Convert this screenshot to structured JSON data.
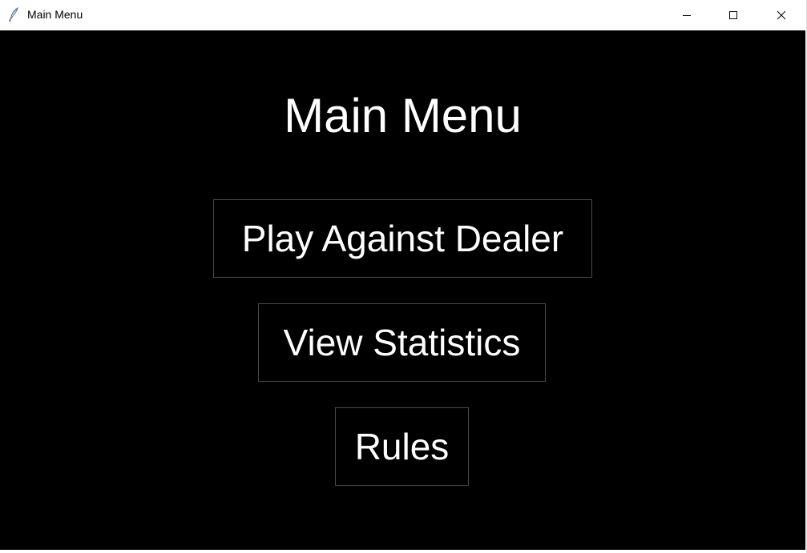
{
  "window": {
    "title": "Main Menu",
    "icon": "feather-icon",
    "controls": [
      "minimize-icon",
      "maximize-icon",
      "close-icon"
    ]
  },
  "main": {
    "title": "Main Menu",
    "buttons": [
      {
        "label": "Play Against Dealer"
      },
      {
        "label": "View Statistics"
      },
      {
        "label": "Rules"
      }
    ]
  },
  "colors": {
    "background": "#000000",
    "text": "#ffffff",
    "button_border": "#4a4a4a",
    "titlebar": "#ffffff"
  }
}
